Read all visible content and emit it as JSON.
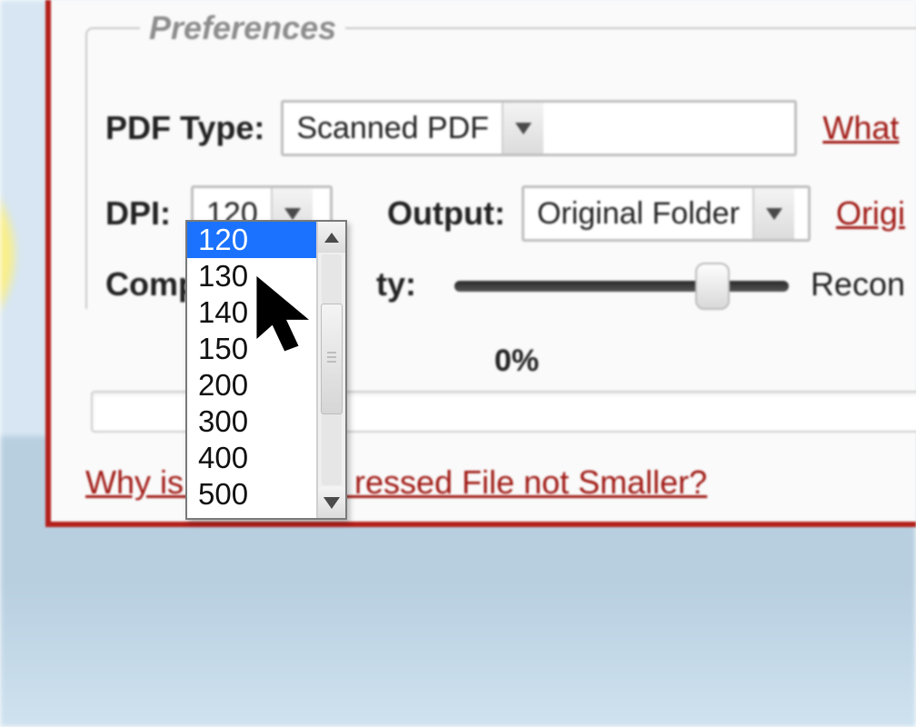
{
  "prefs": {
    "legend": "Preferences",
    "pdf_type_label": "PDF Type:",
    "pdf_type_value": "Scanned PDF",
    "what_link": "What",
    "dpi_label": "DPI:",
    "dpi_value": "120",
    "dpi_options": [
      "120",
      "130",
      "140",
      "150",
      "200",
      "300",
      "400",
      "500"
    ],
    "dpi_selected_index": 0,
    "output_label": "Output:",
    "output_value": "Original Folder",
    "origi_link": "Origi",
    "compression_label_left": "Comp",
    "compression_label_right": "ty:",
    "recon_label": "Recon"
  },
  "progress": {
    "percent_text": "0%"
  },
  "links": {
    "why_left": "Why is",
    "why_right": "ressed File not Smaller?"
  }
}
